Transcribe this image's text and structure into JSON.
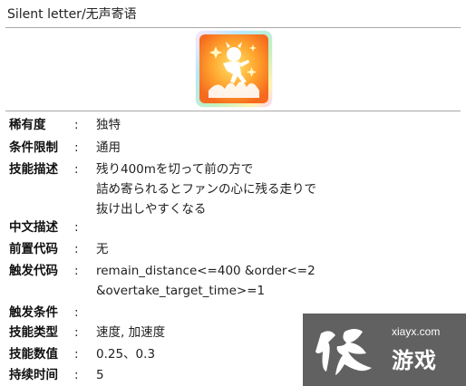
{
  "header": {
    "title": "Silent letter/无声寄语"
  },
  "skill_icon": {
    "name": "skill-icon"
  },
  "rows": [
    {
      "label": "稀有度",
      "colon": ":",
      "lines": [
        "独特"
      ]
    },
    {
      "label": "条件限制",
      "colon": ":",
      "lines": [
        "通用"
      ]
    },
    {
      "label": "技能描述",
      "colon": ":",
      "lines": [
        "残り400mを切って前の方で",
        "詰め寄られるとファンの心に残る走りで",
        "抜け出しやすくなる"
      ]
    },
    {
      "label": "中文描述",
      "colon": ":",
      "lines": []
    },
    {
      "label": "前置代码",
      "colon": ":",
      "lines": [
        "无"
      ]
    },
    {
      "label": "触发代码",
      "colon": ":",
      "lines": [
        "remain_distance<=400 &order<=2",
        "&overtake_target_time>=1"
      ]
    },
    {
      "label": "触发条件",
      "colon": ":",
      "lines": []
    },
    {
      "label": "技能类型",
      "colon": ":",
      "lines": [
        "速度, 加速度"
      ]
    },
    {
      "label": "技能数值",
      "colon": ":",
      "lines": [
        "0.25、0.3"
      ]
    },
    {
      "label": "持续时间",
      "colon": ":",
      "lines": [
        "5"
      ]
    }
  ],
  "watermark": {
    "site": "xiayx.com",
    "name": "游戏"
  }
}
